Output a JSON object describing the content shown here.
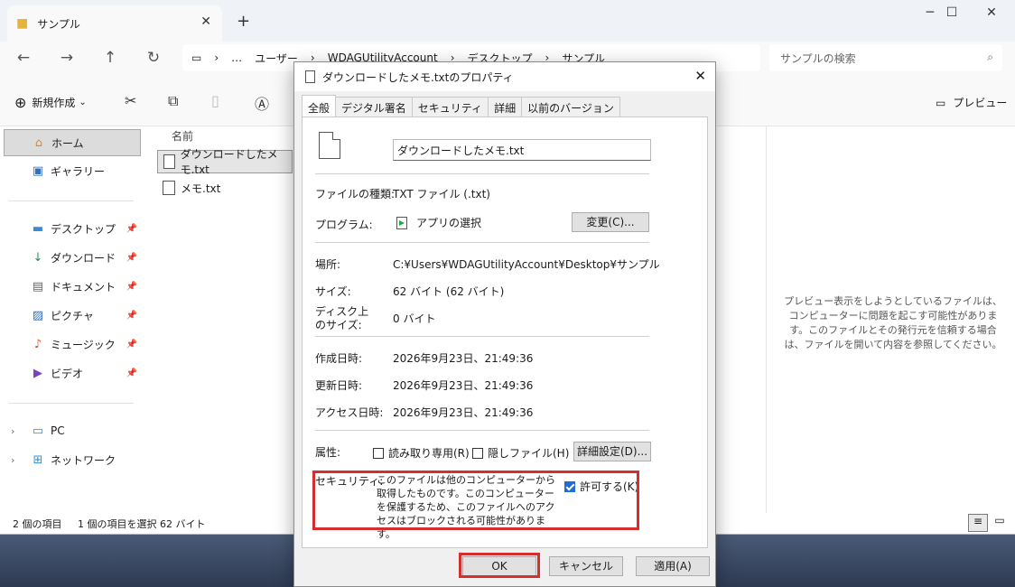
{
  "explorer": {
    "tab_title": "サンプル",
    "address": [
      "ユーザー",
      "WDAGUtilityAccount",
      "デスクトップ",
      "サンプル"
    ],
    "address_more": "…",
    "search_placeholder": "サンプルの検索",
    "toolbar": {
      "new_label": "新規作成",
      "preview_label": "プレビュー"
    },
    "sidebar": {
      "home": "ホーム",
      "gallery": "ギャラリー",
      "quick": [
        "デスクトップ",
        "ダウンロード",
        "ドキュメント",
        "ピクチャ",
        "ミュージック",
        "ビデオ"
      ],
      "pc": "PC",
      "network": "ネットワーク"
    },
    "column_name": "名前",
    "files": [
      "ダウンロードしたメモ.txt",
      "メモ.txt"
    ],
    "preview_message": "プレビュー表示をしようとしているファイルは、コンピューターに問題を起こす可能性があります。このファイルとその発行元を信頼する場合は、ファイルを開いて内容を参照してください。",
    "status": {
      "count": "2 個の項目",
      "selected": "1 個の項目を選択  62 バイト"
    }
  },
  "dialog": {
    "title": "ダウンロードしたメモ.txtのプロパティ",
    "tabs": [
      "全般",
      "デジタル署名",
      "セキュリティ",
      "詳細",
      "以前のバージョン"
    ],
    "file_name": "ダウンロードしたメモ.txt",
    "type_label": "ファイルの種類:",
    "type_value": "TXT ファイル (.txt)",
    "program_label": "プログラム:",
    "program_value": "アプリの選択",
    "change_button": "変更(C)...",
    "location_label": "場所:",
    "location_value": "C:¥Users¥WDAGUtilityAccount¥Desktop¥サンプル",
    "size_label": "サイズ:",
    "size_value": "62 バイト (62 バイト)",
    "disk_label_1": "ディスク上",
    "disk_label_2": "のサイズ:",
    "disk_value": "0 バイト",
    "created_label": "作成日時:",
    "created_value": "2026年9月23日、21:49:36",
    "modified_label": "更新日時:",
    "modified_value": "2026年9月23日、21:49:36",
    "accessed_label": "アクセス日時:",
    "accessed_value": "2026年9月23日、21:49:36",
    "attr_label": "属性:",
    "readonly_label": "読み取り専用(R)",
    "hidden_label": "隠しファイル(H)",
    "advanced_button": "詳細設定(D)...",
    "security_label": "セキュリティ:",
    "security_text": "このファイルは他のコンピューターから取得したものです。このコンピューターを保護するため、このファイルへのアクセスはブロックされる可能性があります。",
    "allow_label": "許可する(K)",
    "ok_button": "OK",
    "cancel_button": "キャンセル",
    "apply_button": "適用(A)"
  },
  "colors": {
    "highlight": "#d32f2f",
    "check_blue": "#1f6fd1"
  }
}
